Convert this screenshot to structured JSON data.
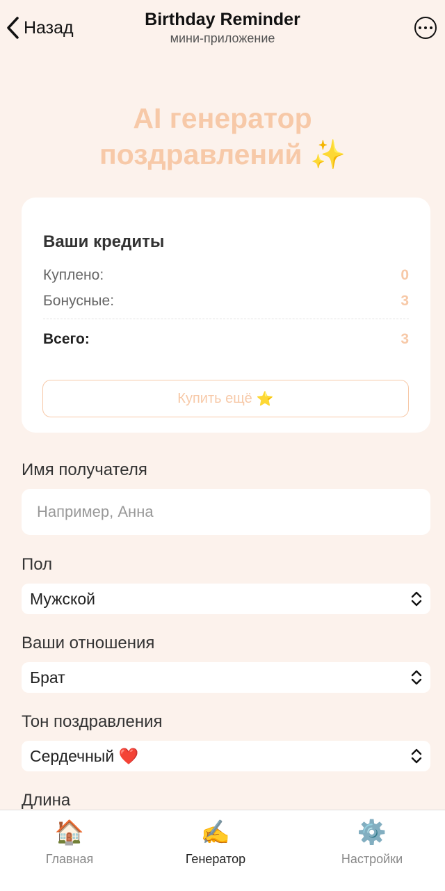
{
  "nav": {
    "back_label": "Назад",
    "title": "Birthday Reminder",
    "subtitle": "мини-приложение"
  },
  "hero": {
    "line1": "AI генератор",
    "line2": "поздравлений ✨"
  },
  "credits": {
    "title": "Ваши кредиты",
    "purchased_label": "Куплено:",
    "purchased_value": "0",
    "bonus_label": "Бонусные:",
    "bonus_value": "3",
    "total_label": "Всего:",
    "total_value": "3",
    "buy_label": "Купить ещё",
    "buy_emoji": "⭐"
  },
  "form": {
    "recipient_label": "Имя получателя",
    "recipient_placeholder": "Например, Анна",
    "recipient_value": "",
    "gender_label": "Пол",
    "gender_value": "Мужской",
    "relation_label": "Ваши отношения",
    "relation_value": "Брат",
    "tone_label": "Тон поздравления",
    "tone_value": "Сердечный ❤️",
    "length_label": "Длина"
  },
  "tabs": [
    {
      "icon": "🏠",
      "label": "Главная",
      "icon_name": "house-icon",
      "active": false
    },
    {
      "icon": "✍️",
      "label": "Генератор",
      "icon_name": "writing-hand-icon",
      "active": true
    },
    {
      "icon": "⚙️",
      "label": "Настройки",
      "icon_name": "gear-icon",
      "active": false
    }
  ],
  "colors": {
    "background": "#fcf2ec",
    "accent": "#f7c9a8",
    "card": "#ffffff"
  }
}
